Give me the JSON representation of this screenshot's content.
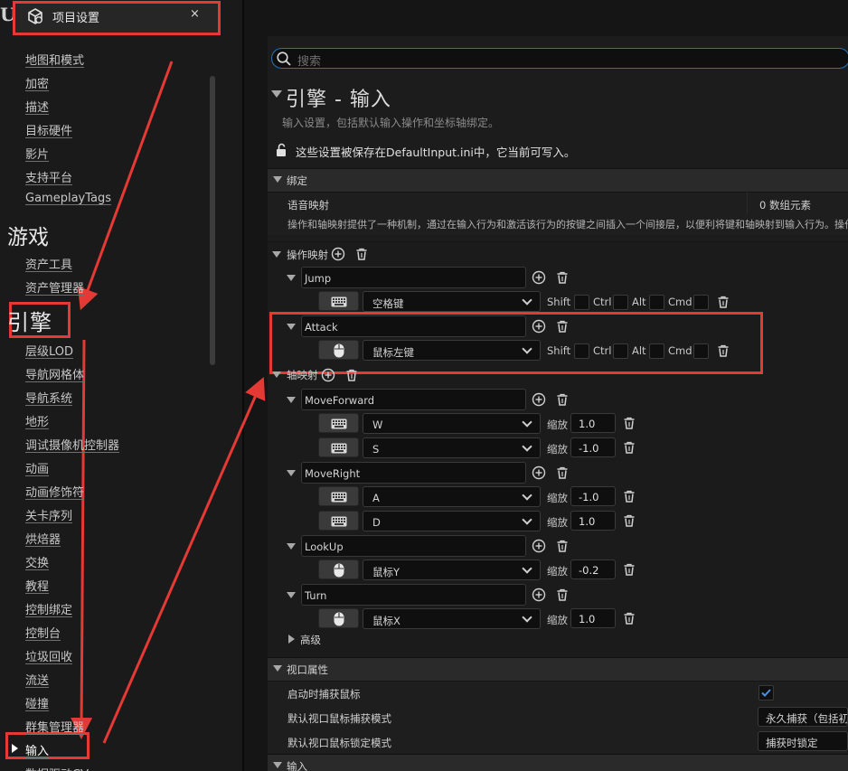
{
  "window": {
    "tab_title": "项目设置",
    "tab_close": "×"
  },
  "sidebar": {
    "items_top": [
      "地图和模式",
      "加密",
      "描述",
      "目标硬件",
      "影片",
      "支持平台",
      "GameplayTags"
    ],
    "section_game": "游戏",
    "items_game": [
      "资产工具",
      "资产管理器"
    ],
    "section_engine": "引擎",
    "items_engine": [
      "层级LOD",
      "导航网格体",
      "导航系统",
      "地形",
      "调试摄像机控制器",
      "动画",
      "动画修饰符",
      "关卡序列",
      "烘焙器",
      "交换",
      "教程",
      "控制绑定",
      "控制台",
      "垃圾回收",
      "流送",
      "碰撞",
      "群集管理器",
      "输入",
      "数据驱动CVars"
    ],
    "selected_item": "输入"
  },
  "search": {
    "placeholder": "搜索"
  },
  "page": {
    "title": "引擎 - 输入",
    "description": "输入设置，包括默认输入操作和坐标轴绑定。",
    "save_notice": "这些设置被保存在DefaultInput.ini中，它当前可写入。"
  },
  "bindings": {
    "header": "绑定",
    "speech_label": "语音映射",
    "speech_value": "0 数组元素",
    "info": "操作和轴映射提供了一种机制，通过在输入行为和激活该行为的按键之间插入一个间接层，以便利将键和轴映射到输入行为。操作",
    "action_header": "操作映射",
    "axis_header": "轴映射",
    "advanced": "高级"
  },
  "modifiers": [
    "Shift",
    "Ctrl",
    "Alt",
    "Cmd"
  ],
  "scale_label": "缩放",
  "actions": [
    {
      "name": "Jump",
      "key": "空格键",
      "device": "keyboard-icon"
    },
    {
      "name": "Attack",
      "key": "鼠标左键",
      "device": "mouse-icon"
    }
  ],
  "axes": [
    {
      "name": "MoveForward",
      "keys": [
        {
          "key": "W",
          "scale": "1.0",
          "device": "keyboard-icon"
        },
        {
          "key": "S",
          "scale": "-1.0",
          "device": "keyboard-icon"
        }
      ]
    },
    {
      "name": "MoveRight",
      "keys": [
        {
          "key": "A",
          "scale": "-1.0",
          "device": "keyboard-icon"
        },
        {
          "key": "D",
          "scale": "1.0",
          "device": "keyboard-icon"
        }
      ]
    },
    {
      "name": "LookUp",
      "keys": [
        {
          "key": "鼠标Y",
          "scale": "-0.2",
          "device": "mouse-icon"
        }
      ]
    },
    {
      "name": "Turn",
      "keys": [
        {
          "key": "鼠标X",
          "scale": "1.0",
          "device": "mouse-icon"
        }
      ]
    }
  ],
  "viewport": {
    "header": "视口属性",
    "capture_on_start": "启动时捕获鼠标",
    "capture_on_start_checked": true,
    "capture_mode_label": "默认视口鼠标捕获模式",
    "capture_mode_value": "永久捕获（包括初始",
    "lock_mode_label": "默认视口鼠标锁定模式",
    "lock_mode_value": "捕获时锁定"
  },
  "input_section": {
    "header": "输入"
  },
  "colors": {
    "annotation_red": "#e53935",
    "accent_blue": "#2d6fb0"
  }
}
